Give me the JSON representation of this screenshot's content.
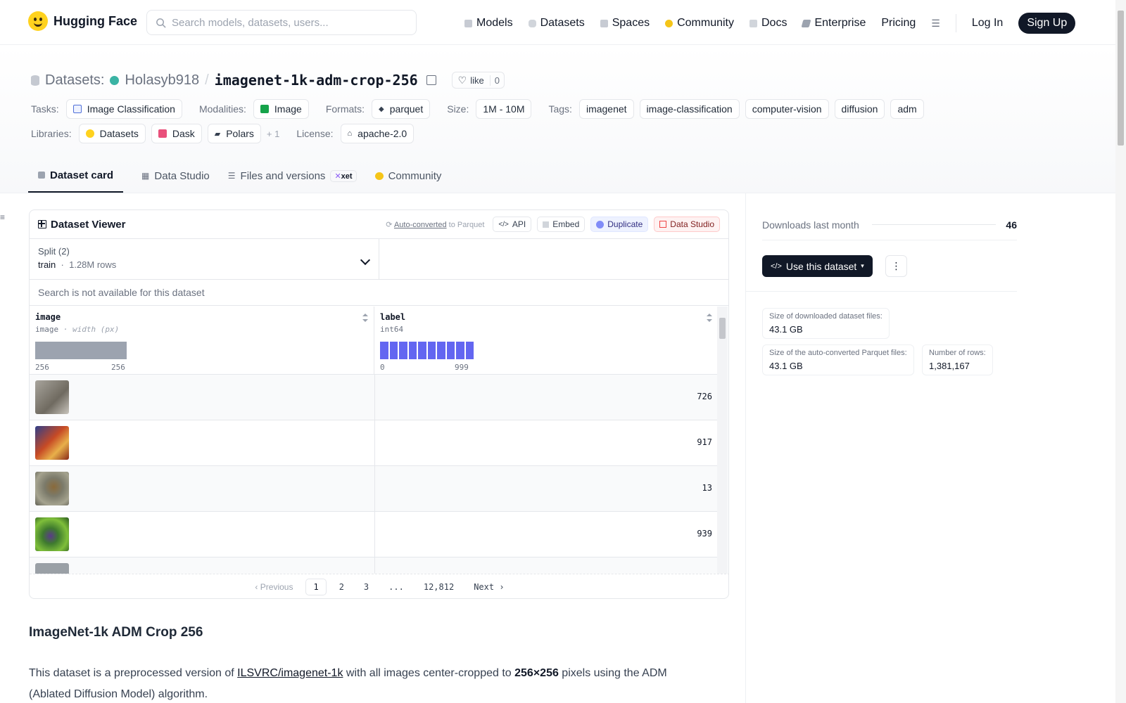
{
  "nav": {
    "brand": "Hugging Face",
    "search_placeholder": "Search models, datasets, users...",
    "links": [
      "Models",
      "Datasets",
      "Spaces",
      "Community",
      "Docs",
      "Enterprise",
      "Pricing"
    ],
    "login": "Log In",
    "signup": "Sign Up"
  },
  "header": {
    "section": "Datasets:",
    "owner": "Holasyb918",
    "separator": "/",
    "repo": "imagenet-1k-adm-crop-256",
    "like_label": "like",
    "like_count": "0"
  },
  "meta": {
    "tasks_label": "Tasks:",
    "task": "Image Classification",
    "modalities_label": "Modalities:",
    "modality": "Image",
    "formats_label": "Formats:",
    "format": "parquet",
    "size_label": "Size:",
    "size": "1M - 10M",
    "tags_label": "Tags:",
    "tags": [
      "imagenet",
      "image-classification",
      "computer-vision",
      "diffusion",
      "adm"
    ],
    "libraries_label": "Libraries:",
    "libraries": [
      "Datasets",
      "Dask",
      "Polars"
    ],
    "libraries_more": "+ 1",
    "license_label": "License:",
    "license": "apache-2.0"
  },
  "tabs": {
    "card": "Dataset card",
    "studio": "Data Studio",
    "files": "Files and versions",
    "xet": "xet",
    "community": "Community"
  },
  "viewer": {
    "title": "Dataset Viewer",
    "auto_converted": "Auto-converted",
    "to_parquet": "to Parquet",
    "api": "API",
    "embed": "Embed",
    "duplicate": "Duplicate",
    "data_studio": "Data Studio",
    "split_label": "Split (2)",
    "split_name": "train",
    "split_dot": "·",
    "split_rows": "1.28M rows",
    "search_text": "Search is not available for this dataset",
    "columns": [
      {
        "name": "image",
        "type": "image",
        "type_extra": "· width (px)",
        "min": "256",
        "max": "256"
      },
      {
        "name": "label",
        "type": "int64",
        "type_extra": "",
        "min": "0",
        "max": "999"
      }
    ],
    "rows": [
      {
        "label": "726",
        "thumb_color": "#8f8a82"
      },
      {
        "label": "917",
        "thumb_color": "#a8482e"
      },
      {
        "label": "13",
        "thumb_color": "#7b7a6a"
      },
      {
        "label": "939",
        "thumb_color": "#3e7a2e"
      }
    ],
    "pager": {
      "prev": "Previous",
      "pages": [
        "1",
        "2",
        "3",
        "...",
        "12,812"
      ],
      "next": "Next"
    }
  },
  "readme": {
    "heading": "ImageNet-1k ADM Crop 256",
    "p1_pre": "This dataset is a preprocessed version of ",
    "p1_link": "ILSVRC/imagenet-1k",
    "p1_mid": " with all images center-cropped to ",
    "p1_bold": "256×256",
    "p1_post": " pixels using the ADM (Ablated Diffusion Model) algorithm."
  },
  "side": {
    "downloads_label": "Downloads last month",
    "downloads": "46",
    "use_button": "Use this dataset",
    "size_dl_label": "Size of downloaded dataset files:",
    "size_dl": "43.1 GB",
    "size_parquet_label": "Size of the auto-converted Parquet files:",
    "size_parquet": "43.1 GB",
    "rows_label": "Number of rows:",
    "rows": "1,381,167"
  },
  "colors": {
    "accent": "#6366f1",
    "brand": "#ffd21e",
    "dark": "#111827"
  }
}
